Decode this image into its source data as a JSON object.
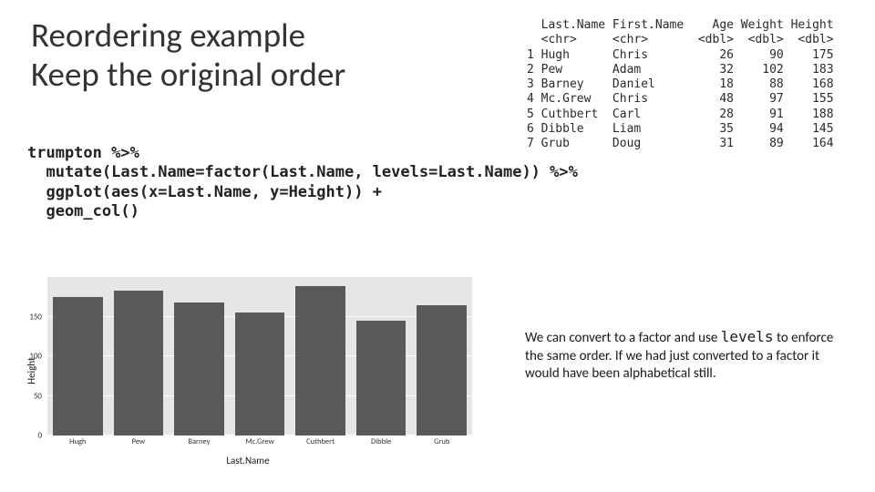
{
  "title_line1": "Reordering example",
  "title_line2": "Keep the original order",
  "table": {
    "headers": [
      "",
      "Last.Name",
      "First.Name",
      "Age",
      "Weight",
      "Height"
    ],
    "types": [
      "",
      "<chr>",
      "<chr>",
      "<dbl>",
      "<dbl>",
      "<dbl>"
    ],
    "rows": [
      [
        "1",
        "Hugh",
        "Chris",
        "26",
        "90",
        "175"
      ],
      [
        "2",
        "Pew",
        "Adam",
        "32",
        "102",
        "183"
      ],
      [
        "3",
        "Barney",
        "Daniel",
        "18",
        "88",
        "168"
      ],
      [
        "4",
        "Mc.Grew",
        "Chris",
        "48",
        "97",
        "155"
      ],
      [
        "5",
        "Cuthbert",
        "Carl",
        "28",
        "91",
        "188"
      ],
      [
        "6",
        "Dibble",
        "Liam",
        "35",
        "94",
        "145"
      ],
      [
        "7",
        "Grub",
        "Doug",
        "31",
        "89",
        "164"
      ]
    ]
  },
  "code": "trumpton %>%\n  mutate(Last.Name=factor(Last.Name, levels=Last.Name)) %>%\n  ggplot(aes(x=Last.Name, y=Height)) +\n  geom_col()",
  "chart_data": {
    "type": "bar",
    "title": "",
    "xlabel": "Last.Name",
    "ylabel": "Height",
    "categories": [
      "Hugh",
      "Pew",
      "Barney",
      "Mc.Grew",
      "Cuthbert",
      "Dibble",
      "Grub"
    ],
    "values": [
      175,
      183,
      168,
      155,
      188,
      145,
      164
    ],
    "ylim": [
      0,
      200
    ],
    "y_ticks": [
      0,
      50,
      100,
      150
    ],
    "bar_fill": "#595959",
    "panel_bg": "#e6e6e6"
  },
  "explain_parts": {
    "p1": "We can convert to a factor and use ",
    "kw": "levels",
    "p2": " to enforce the same order.  If we had just converted to a factor it would have been alphabetical still."
  }
}
